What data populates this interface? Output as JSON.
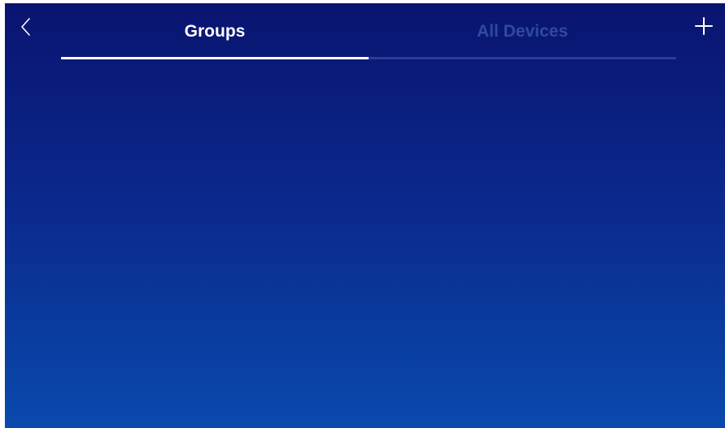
{
  "header": {
    "back_icon": "chevron-left-icon",
    "add_icon": "plus-icon"
  },
  "tabs": [
    {
      "label": "Groups",
      "active": true
    },
    {
      "label": "All Devices",
      "active": false
    }
  ],
  "colors": {
    "background_top": "#0a1470",
    "background_bottom": "#0a4aad",
    "active_tab_text": "#ffffff",
    "inactive_tab_text": "#2f4a9c",
    "indicator": "#ffffff",
    "track": "#2a3f93"
  }
}
